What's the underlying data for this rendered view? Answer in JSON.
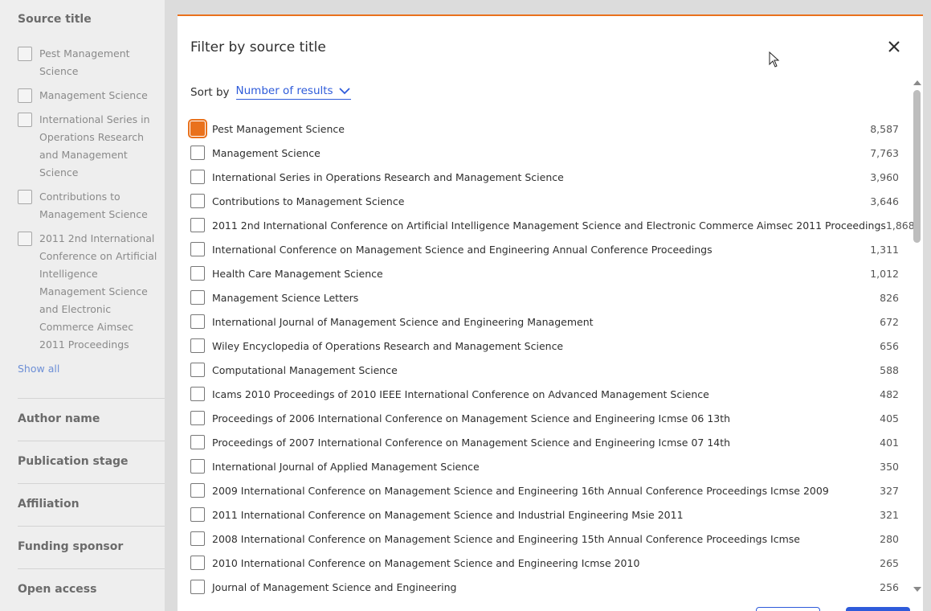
{
  "sidebar": {
    "source_title_heading": "Source title",
    "items": [
      {
        "label": "Pest Management Science"
      },
      {
        "label": "Management Science"
      },
      {
        "label": "International Series in Operations Research and Management Science"
      },
      {
        "label": "Contributions to Management Science"
      },
      {
        "label": "2011 2nd International Conference on Artificial Intelligence Management Science and Electronic Commerce Aimsec 2011 Proceedings"
      }
    ],
    "show_all": "Show all",
    "sections": [
      "Author name",
      "Publication stage",
      "Affiliation",
      "Funding sponsor",
      "Open access"
    ]
  },
  "modal": {
    "title": "Filter by source title",
    "sort_label": "Sort by",
    "sort_value": "Number of results",
    "accent_color": "#e9711c",
    "link_color": "#2e5bda",
    "rows": [
      {
        "label": "Pest Management Science",
        "count": "8,587",
        "checked": true
      },
      {
        "label": "Management Science",
        "count": "7,763",
        "checked": false
      },
      {
        "label": "International Series in Operations Research and Management Science",
        "count": "3,960",
        "checked": false
      },
      {
        "label": "Contributions to Management Science",
        "count": "3,646",
        "checked": false
      },
      {
        "label": "2011 2nd International Conference on Artificial Intelligence Management Science and Electronic Commerce Aimsec 2011 Proceedings",
        "count": "1,868",
        "checked": false
      },
      {
        "label": "International Conference on Management Science and Engineering Annual Conference Proceedings",
        "count": "1,311",
        "checked": false
      },
      {
        "label": "Health Care Management Science",
        "count": "1,012",
        "checked": false
      },
      {
        "label": "Management Science Letters",
        "count": "826",
        "checked": false
      },
      {
        "label": "International Journal of Management Science and Engineering Management",
        "count": "672",
        "checked": false
      },
      {
        "label": "Wiley Encyclopedia of Operations Research and Management Science",
        "count": "656",
        "checked": false
      },
      {
        "label": "Computational Management Science",
        "count": "588",
        "checked": false
      },
      {
        "label": "Icams 2010 Proceedings of 2010 IEEE International Conference on Advanced Management Science",
        "count": "482",
        "checked": false
      },
      {
        "label": "Proceedings of 2006 International Conference on Management Science and Engineering Icmse 06 13th",
        "count": "405",
        "checked": false
      },
      {
        "label": "Proceedings of 2007 International Conference on Management Science and Engineering Icmse 07 14th",
        "count": "401",
        "checked": false
      },
      {
        "label": "International Journal of Applied Management Science",
        "count": "350",
        "checked": false
      },
      {
        "label": "2009 International Conference on Management Science and Engineering 16th Annual Conference Proceedings Icmse 2009",
        "count": "327",
        "checked": false
      },
      {
        "label": "2011 International Conference on Management Science and Industrial Engineering Msie 2011",
        "count": "321",
        "checked": false
      },
      {
        "label": "2008 International Conference on Management Science and Engineering 15th Annual Conference Proceedings Icmse",
        "count": "280",
        "checked": false
      },
      {
        "label": "2010 International Conference on Management Science and Engineering Icmse 2010",
        "count": "265",
        "checked": false
      },
      {
        "label": "Journal of Management Science and Engineering",
        "count": "256",
        "checked": false
      }
    ]
  }
}
